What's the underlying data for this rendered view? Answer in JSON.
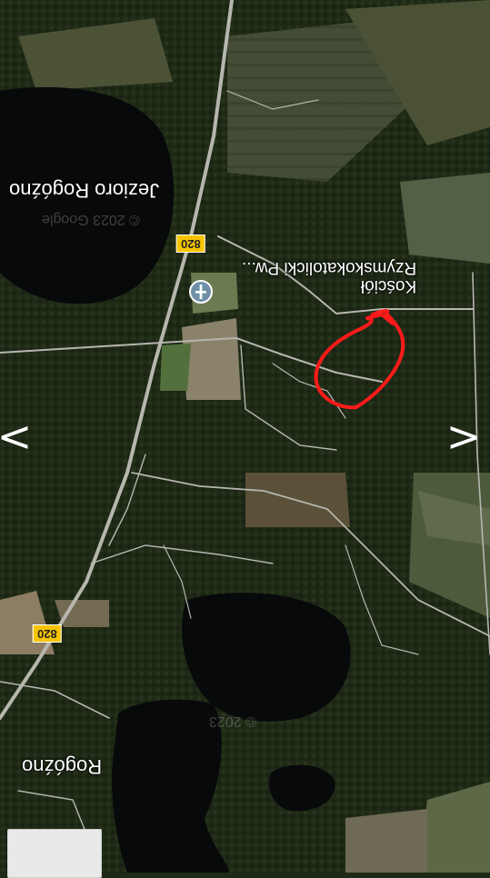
{
  "map": {
    "lake_label": "Jezioro Rogóźno",
    "town_label": "Rogóźno",
    "poi_label_line1": "Kościół",
    "poi_label_line2": "Rzymskokatolicki Pw...",
    "poi_icon": "church-pin-icon",
    "road_number_1": "820",
    "road_number_2": "820",
    "watermark_1": "© 2023 Google",
    "watermark_2": "© 2023"
  },
  "navigation": {
    "prev_label": "<",
    "next_label": ">"
  },
  "colors": {
    "water": "#080b0c",
    "forest": "#1d2814",
    "field": "#4f5537",
    "road": "#b6b6ae",
    "annotation": "#ff1a1a",
    "shield": "#f6c400"
  }
}
